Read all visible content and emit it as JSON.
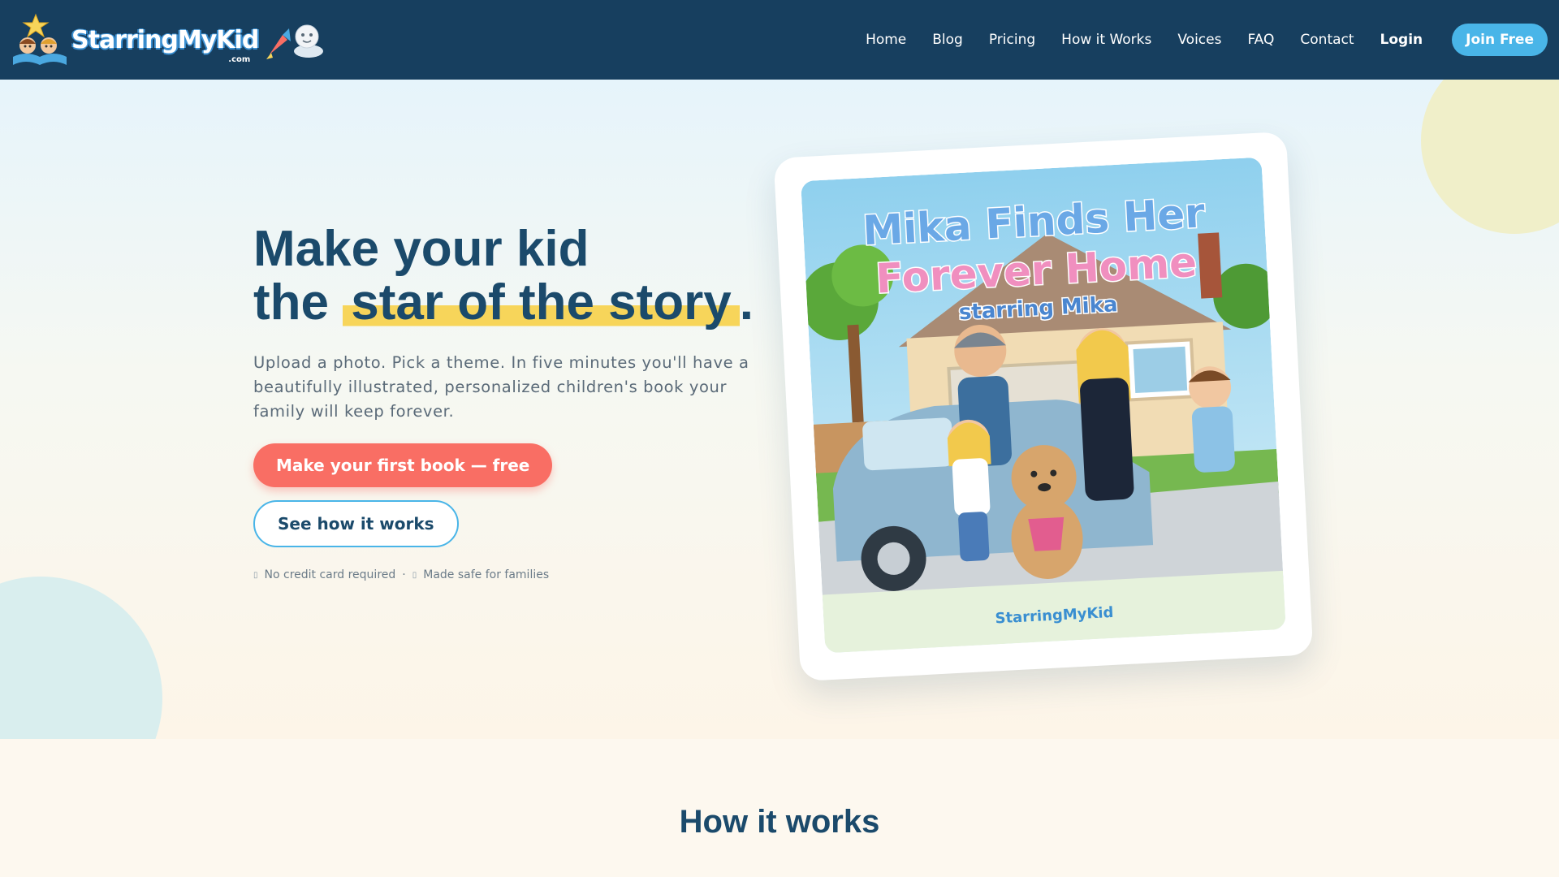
{
  "brand": {
    "name": "StarringMyKid",
    "sub": ".com",
    "colors": {
      "nav_bg": "#173f5f",
      "accent_blue": "#49b5e8",
      "accent_coral": "#f96e64",
      "highlight": "#f7d55a",
      "heading": "#1b4a6b"
    }
  },
  "nav": {
    "links": [
      "Home",
      "Blog",
      "Pricing",
      "How it Works",
      "Voices",
      "FAQ",
      "Contact"
    ],
    "login": "Login",
    "join": "Join Free"
  },
  "hero": {
    "headline_line1": "Make your kid",
    "headline_line2_prefix": "the",
    "headline_highlight": "star of the story",
    "headline_suffix": ".",
    "subtext": "Upload a photo. Pick a theme. In five minutes you'll have a beautifully illustrated, personalized children's book your family will keep forever.",
    "primary_cta": "Make your first book — free",
    "secondary_cta": "See how it works",
    "trust_1": "No credit card required",
    "trust_sep": "·",
    "trust_2": "Made safe for families",
    "trust_icon_1": "card-icon",
    "trust_icon_2": "shield-icon"
  },
  "book": {
    "title_line1": "Mika Finds Her",
    "title_line2": "Forever Home",
    "subtitle": "starring Mika",
    "footer_logo": "StarringMyKid"
  },
  "how": {
    "title": "How it works"
  }
}
